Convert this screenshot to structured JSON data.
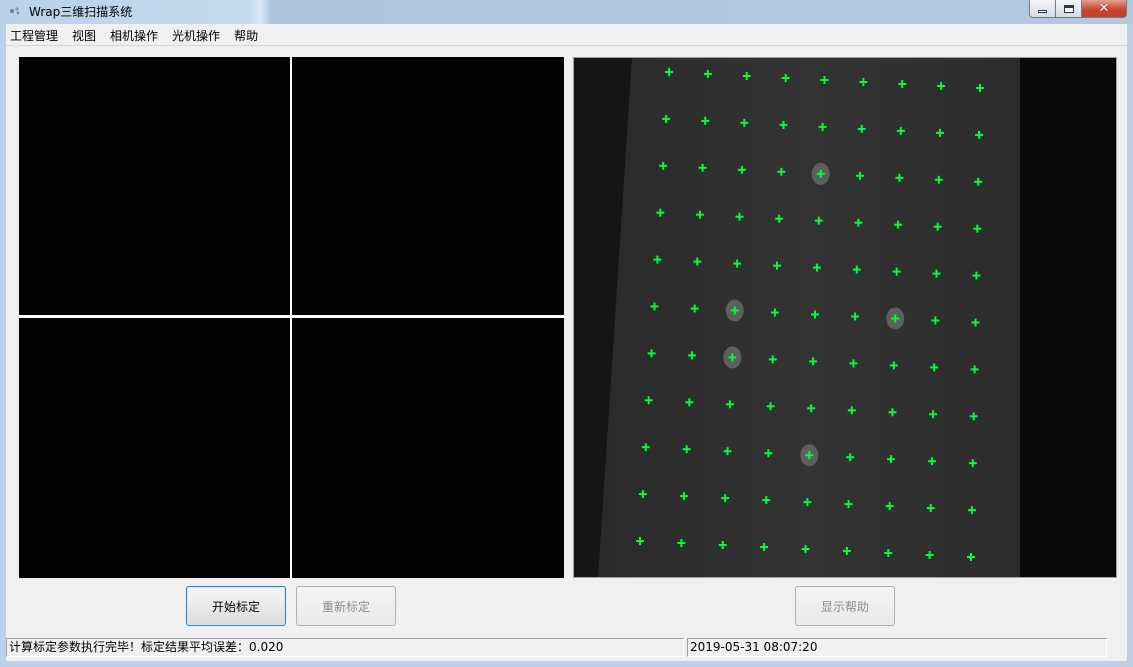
{
  "window": {
    "title": "Wrap三维扫描系统",
    "close_glyph": "✕"
  },
  "menu": {
    "items": [
      "工程管理",
      "视图",
      "相机操作",
      "光机操作",
      "帮助"
    ]
  },
  "buttons": {
    "start_calibration": "开始标定",
    "recalibrate": "重新标定",
    "show_help": "显示帮助"
  },
  "status": {
    "message": "计算标定参数执行完毕！标定结果平均误差：0.020",
    "datetime": "2019-05-31 08:07:20"
  },
  "colors": {
    "marker": "#00ff33",
    "circle": "#5e5e5e"
  },
  "calibration_board": {
    "rows": 11,
    "cols": 9,
    "circled_points": [
      [
        2,
        4
      ],
      [
        5,
        2
      ],
      [
        5,
        6
      ],
      [
        6,
        2
      ],
      [
        8,
        4
      ]
    ]
  }
}
